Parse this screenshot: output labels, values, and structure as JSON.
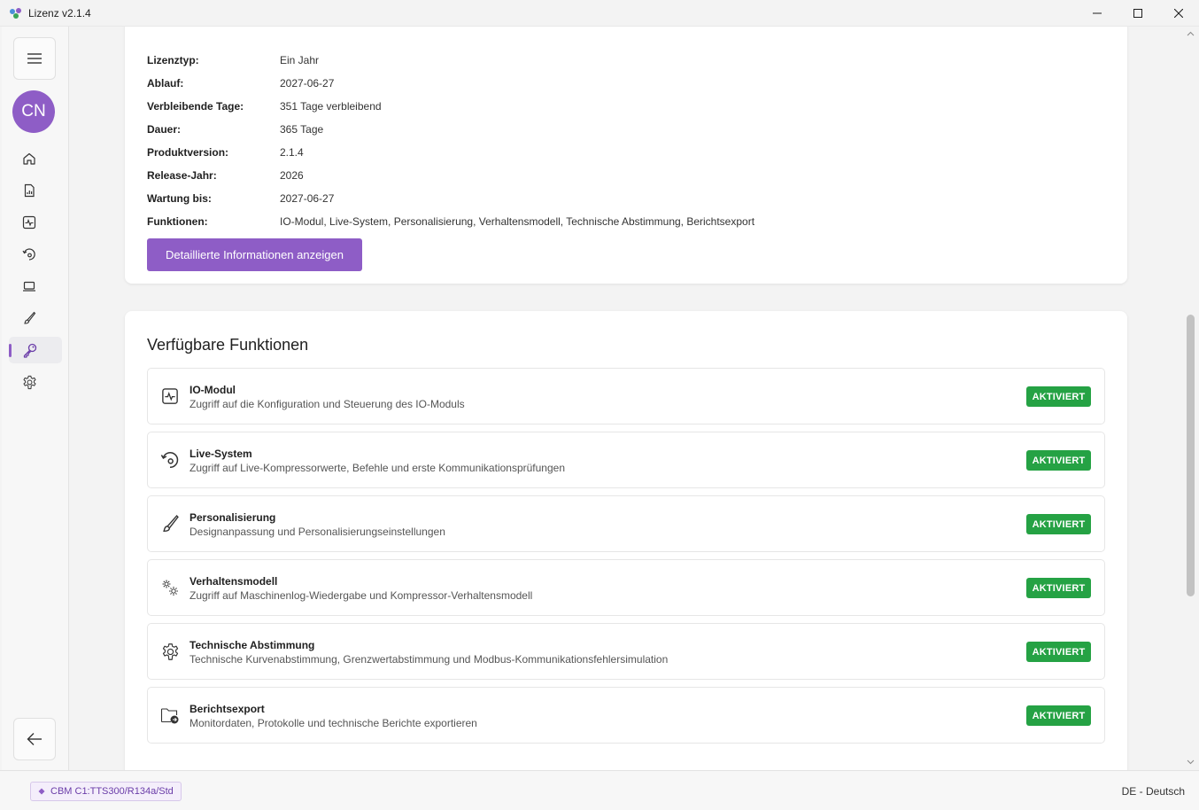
{
  "window": {
    "title": "Lizenz v2.1.4"
  },
  "sidebar": {
    "avatar_initials": "CN",
    "items": [
      {
        "icon": "home-icon"
      },
      {
        "icon": "report-icon"
      },
      {
        "icon": "activity-icon"
      },
      {
        "icon": "live-icon"
      },
      {
        "icon": "laptop-icon"
      },
      {
        "icon": "brush-icon"
      },
      {
        "icon": "key-icon",
        "active": true
      },
      {
        "icon": "gear-icon"
      }
    ]
  },
  "license": {
    "rows": [
      {
        "label": "Lizenztyp:",
        "value": "Ein Jahr"
      },
      {
        "label": "Ablauf:",
        "value": "2027-06-27"
      },
      {
        "label": "Verbleibende Tage:",
        "value": "351 Tage verbleibend"
      },
      {
        "label": "Dauer:",
        "value": "365 Tage"
      },
      {
        "label": "Produktversion:",
        "value": "2.1.4"
      },
      {
        "label": "Release-Jahr:",
        "value": "2026"
      },
      {
        "label": "Wartung bis:",
        "value": "2027-06-27"
      },
      {
        "label": "Funktionen:",
        "value": "IO-Modul, Live-System, Personalisierung, Verhaltensmodell, Technische Abstimmung, Berichtsexport"
      }
    ],
    "detail_button": "Detaillierte Informationen anzeigen"
  },
  "functions": {
    "title": "Verfügbare Funktionen",
    "items": [
      {
        "name": "IO-Modul",
        "description": "Zugriff auf die Konfiguration und Steuerung des IO-Moduls",
        "status": "AKTIVIERT",
        "icon": "activity-icon"
      },
      {
        "name": "Live-System",
        "description": "Zugriff auf Live-Kompressorwerte, Befehle und erste Kommunikationsprüfungen",
        "status": "AKTIVIERT",
        "icon": "live-icon"
      },
      {
        "name": "Personalisierung",
        "description": "Designanpassung und Personalisierungseinstellungen",
        "status": "AKTIVIERT",
        "icon": "brush-icon"
      },
      {
        "name": "Verhaltensmodell",
        "description": "Zugriff auf Maschinenlog-Wiedergabe und Kompressor-Verhaltensmodell",
        "status": "AKTIVIERT",
        "icon": "gears-icon"
      },
      {
        "name": "Technische Abstimmung",
        "description": "Technische Kurvenabstimmung, Grenzwertabstimmung und Modbus-Kommunikationsfehlersimulation",
        "status": "AKTIVIERT",
        "icon": "gear-icon"
      },
      {
        "name": "Berichtsexport",
        "description": "Monitordaten, Protokolle und technische Berichte exportieren",
        "status": "AKTIVIERT",
        "icon": "folder-export-icon"
      }
    ]
  },
  "statusbar": {
    "device": "CBM C1:TTS300/R134a/Std",
    "language": "DE - Deutsch"
  },
  "colors": {
    "accent": "#8e5dc6",
    "active_badge": "#25a244"
  }
}
